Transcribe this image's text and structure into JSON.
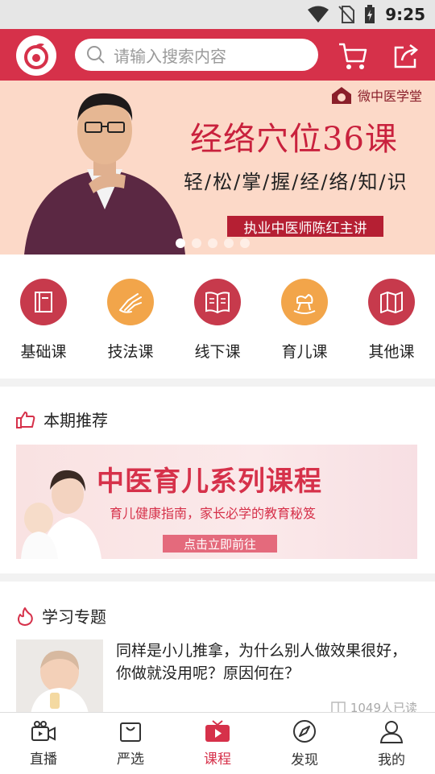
{
  "status_bar": {
    "time": "9:25"
  },
  "search": {
    "placeholder": "请输入搜索内容"
  },
  "banner": {
    "brand": "微中医学堂",
    "title": "经络穴位36课",
    "subtitle": "轻/松/掌/握/经/络/知/识",
    "host": "执业中医师陈红主讲",
    "slides": 5,
    "active_slide": 1
  },
  "categories": [
    {
      "label": "基础课",
      "icon": "book-icon",
      "color": "#c73a4c"
    },
    {
      "label": "技法课",
      "icon": "hand-icon",
      "color": "#f2a54a"
    },
    {
      "label": "线下课",
      "icon": "open-book-icon",
      "color": "#c73a4c"
    },
    {
      "label": "育儿课",
      "icon": "rocking-horse-icon",
      "color": "#f2a54a"
    },
    {
      "label": "其他课",
      "icon": "map-icon",
      "color": "#c73a4c"
    }
  ],
  "recommend": {
    "title": "本期推荐",
    "promo_title": "中医育儿系列课程",
    "promo_subtitle": "育儿健康指南，家长必学的教育秘笈",
    "promo_button": "点击立即前往"
  },
  "topics": {
    "title": "学习专题",
    "article_title": "同样是小儿推拿，为什么别人做效果很好，你做就没用呢？原因何在？",
    "article_reads": "1049人已读"
  },
  "tabs": [
    {
      "label": "直播",
      "icon": "live-video-icon",
      "active": false
    },
    {
      "label": "严选",
      "icon": "shopping-bag-icon",
      "active": false
    },
    {
      "label": "课程",
      "icon": "tv-play-icon",
      "active": true
    },
    {
      "label": "发现",
      "icon": "compass-icon",
      "active": false
    },
    {
      "label": "我的",
      "icon": "user-icon",
      "active": false
    }
  ],
  "colors": {
    "brand": "#d6314a",
    "accent_orange": "#f2a54a"
  }
}
